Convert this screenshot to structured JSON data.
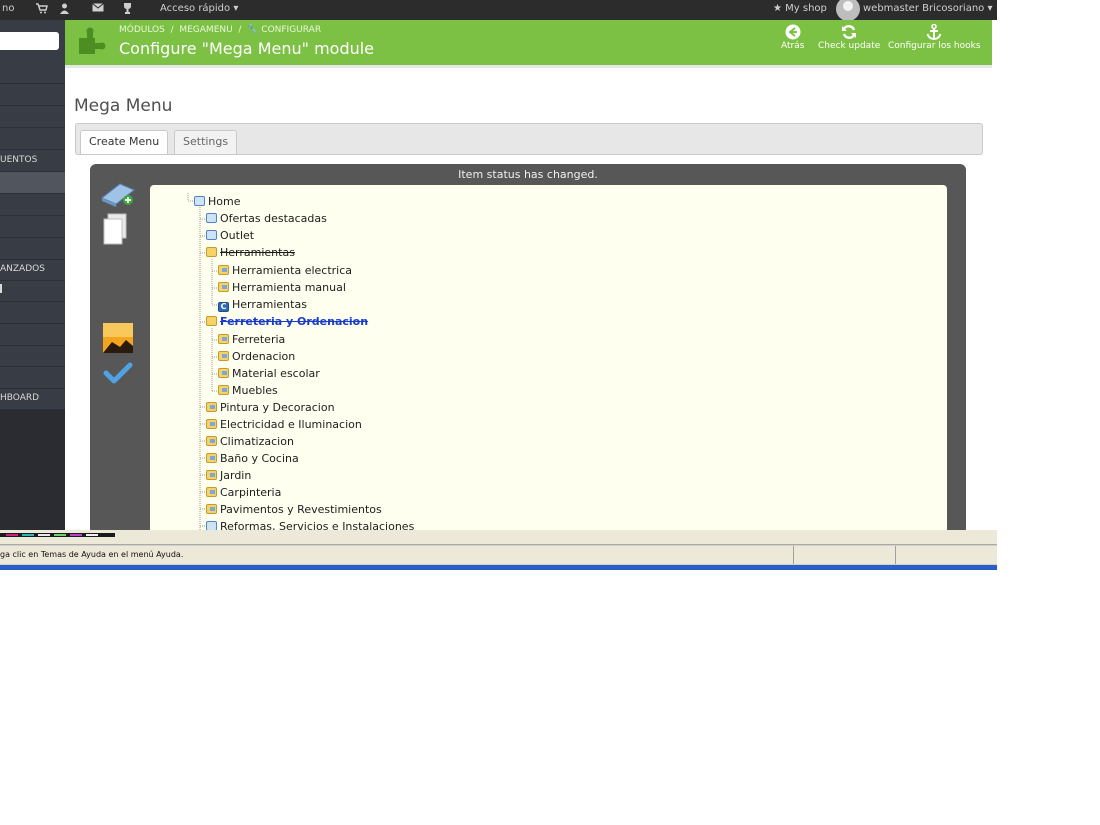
{
  "topbar": {
    "left_text": "no",
    "quick_access": "Acceso rápido",
    "my_shop": "My shop",
    "user": "webmaster Bricosoriano"
  },
  "sidebar": {
    "items": [
      "",
      "",
      "",
      "",
      "UENTOS",
      "",
      "",
      "",
      "",
      "",
      "ANZADOS",
      "",
      "",
      "",
      "",
      "",
      "HBOARD"
    ]
  },
  "header": {
    "breadcrumb_1": "MÓDULOS",
    "breadcrumb_2": "MEGAMENU",
    "breadcrumb_3": "CONFIGURAR",
    "title": "Configure \"Mega Menu\" module",
    "actions": {
      "back": "Atrás",
      "check_update": "Check update",
      "hooks": "Configurar los hooks"
    }
  },
  "main": {
    "page_title": "Mega Menu",
    "tabs": [
      "Create Menu",
      "Settings"
    ],
    "status_message": "Item status has changed."
  },
  "tree": {
    "root": "Home",
    "items": [
      {
        "label": "Ofertas destacadas"
      },
      {
        "label": "Outlet"
      },
      {
        "label": "Herramientas"
      },
      {
        "label": "Herramienta electrica"
      },
      {
        "label": "Herramienta manual"
      },
      {
        "label": "Herramientas"
      },
      {
        "label": "Ferreteria y Ordenacion"
      },
      {
        "label": "Ferreteria"
      },
      {
        "label": "Ordenacion"
      },
      {
        "label": "Material escolar"
      },
      {
        "label": "Muebles"
      },
      {
        "label": "Pintura y Decoracion"
      },
      {
        "label": "Electricidad e Iluminacion"
      },
      {
        "label": "Climatizacion"
      },
      {
        "label": "Baño y Cocina"
      },
      {
        "label": "Jardin"
      },
      {
        "label": "Carpinteria"
      },
      {
        "label": "Pavimentos y Revestimientos"
      },
      {
        "label": "Reformas, Servicios e Instalaciones"
      }
    ]
  },
  "windows_statusbar": {
    "help_text": "ga clic en Temas de Ayuda en el menú Ayuda."
  },
  "colors": {
    "header_green": "#7cc143",
    "sidebar": "#383c44",
    "topbar": "#2c2c2c",
    "editor_bg": "#575757",
    "tree_bg": "#fffff0"
  }
}
